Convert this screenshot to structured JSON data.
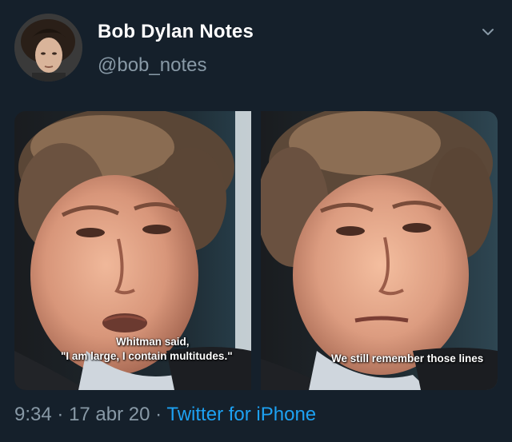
{
  "tweet": {
    "display_name": "Bob Dylan Notes",
    "handle": "@bob_notes",
    "time": "9:34",
    "date": "17 abr 20",
    "separator": "·",
    "source": "Twitter for iPhone",
    "link_color": "#1da1f2",
    "background": "#15202b"
  },
  "media": {
    "left_image": {
      "subtitle_line1": "Whitman said,",
      "subtitle_line2": "\"I am large, I contain multitudes.\""
    },
    "right_image": {
      "subtitle": "We still remember those lines"
    }
  },
  "icons": {
    "menu": "chevron-down-icon"
  }
}
